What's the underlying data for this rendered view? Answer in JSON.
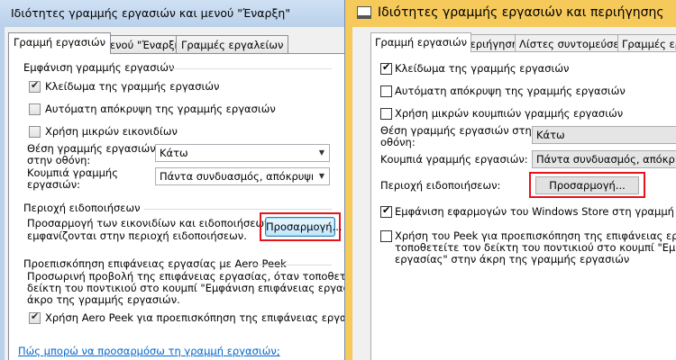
{
  "left_window": {
    "title": "Ιδιότητες γραμμής εργασιών και μενού \"Έναρξη\"",
    "tabs": [
      "Γραμμή εργασιών",
      "Μενού \"Έναρξη\"",
      "Γραμμές εργαλείων"
    ],
    "appearance_group": "Εμφάνιση γραμμής εργασιών",
    "lock_taskbar": "Κλείδωμα της γραμμής εργασιών",
    "auto_hide": "Αυτόματη απόκρυψη της γραμμής εργασιών",
    "small_icons": "Χρήση μικρών εικονιδίων",
    "location_label_1": "Θέση γραμμής εργασιών",
    "location_label_2": "στην οθόνη:",
    "location_value": "Κάτω",
    "buttons_label_1": "Κουμπιά γραμμής",
    "buttons_label_2": "εργασιών:",
    "buttons_value": "Πάντα συνδυασμός, απόκρυψη ετικετών",
    "notification_group": "Περιοχή ειδοποιήσεων",
    "notification_desc_1": "Προσαρμογή των εικονιδίων και ειδοποιήσεων που",
    "notification_desc_2": "εμφανίζονται στην περιοχή ειδοποιήσεων.",
    "customize_button": "Προσαρμογή...",
    "peek_group": "Προεπισκόπηση επιφάνειας εργασίας με Aero Peek",
    "peek_desc_1": "Προσωρινή προβολή της επιφάνειας εργασίας, όταν τοποθετείτε τον",
    "peek_desc_2": "δείκτη του ποντικιού στο κουμπί \"Εμφάνιση επιφάνειας εργασίας\" στο",
    "peek_desc_3": "άκρο της γραμμής εργασιών.",
    "use_peek": "Χρήση Aero Peek για προεπισκόπηση της επιφάνειας εργασίας",
    "help_link": "Πώς μπορώ να προσαρμόσω τη γραμμή εργασιών;"
  },
  "right_window": {
    "title": "Ιδιότητες γραμμής εργασιών και περιήγησης",
    "tabs": [
      "Γραμμή εργασιών",
      "Περιήγηση",
      "Λίστες συντομεύσεων",
      "Γραμμές εργ"
    ],
    "lock_taskbar": "Κλείδωμα της γραμμής εργασιών",
    "auto_hide": "Αυτόματη απόκρυψη της γραμμής εργασιών",
    "small_buttons": "Χρήση μικρών κουμπιών γραμμής εργασιών",
    "location_label_1": "Θέση γραμμής εργασιών στην",
    "location_label_2": "οθόνη:",
    "location_value": "Κάτω",
    "buttons_label": "Κουμπιά γραμμής εργασιών:",
    "buttons_value": "Πάντα συνδυασμός, απόκρ. επικ.",
    "notification_label": "Περιοχή ειδοποιήσεων:",
    "customize_button": "Προσαρμογή...",
    "store_apps": "Εμφάνιση εφαρμογών του Windows Store στη γραμμή εργασιών",
    "peek_1": "Χρήση του Peek για προεπισκόπηση της επιφάνειας εργασίας όταν",
    "peek_2": "τοποθετείτε τον δείκτη του ποντικιού στο κουμπί \"Εμφάνιση επιφάνειας",
    "peek_3": "εργασίας\" στην άκρη της γραμμής εργασιών"
  },
  "checkbox_states": {
    "left": {
      "lock_taskbar": true,
      "auto_hide": false,
      "small_icons": false,
      "use_peek": true
    },
    "right": {
      "lock_taskbar": true,
      "auto_hide": false,
      "small_buttons": false,
      "store_apps": true,
      "peek": false
    }
  },
  "colors": {
    "highlight_box": "#e8121b",
    "win8_title": "#f5c95a",
    "win7_frame": "#b9d1ea",
    "link": "#0066cc"
  }
}
